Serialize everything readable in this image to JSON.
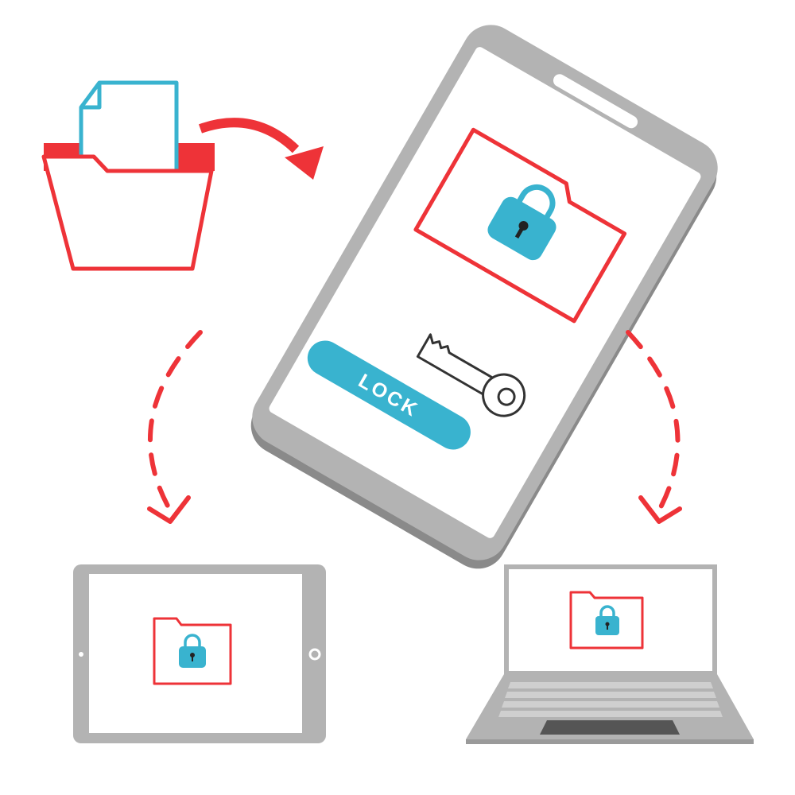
{
  "illustration": {
    "lock_button": {
      "label": "LOCK"
    }
  },
  "colors": {
    "accent_red": "#ee3338",
    "accent_blue": "#39b3cf",
    "device_gray": "#b3b3b3",
    "device_dark": "#8a8a8a",
    "screen_white": "#ffffff",
    "outline_dark": "#333333"
  },
  "icons": [
    "folder-with-document-icon",
    "curved-arrow-icon",
    "smartphone",
    "locked-folder-icon",
    "padlock-icon",
    "key-icon",
    "dashed-arrow-icon",
    "tablet",
    "laptop"
  ]
}
